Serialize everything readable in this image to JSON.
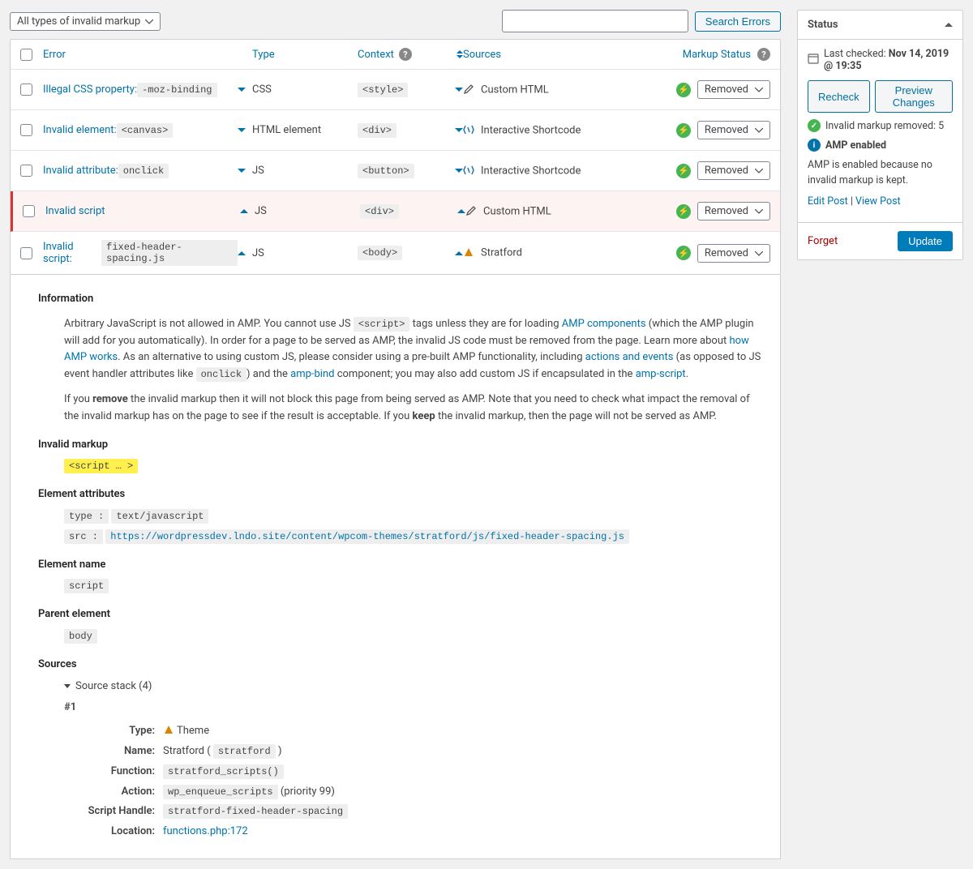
{
  "filter": {
    "label": "All types of invalid markup"
  },
  "search": {
    "button": "Search Errors"
  },
  "columns": {
    "error": "Error",
    "type": "Type",
    "context": "Context",
    "sources": "Sources",
    "status": "Markup Status"
  },
  "rows": [
    {
      "error_prefix": "Illegal CSS property:",
      "error_code": "-moz-binding",
      "type": "CSS",
      "context": "<style>",
      "source": "Custom HTML",
      "source_kind": "pencil",
      "status": "Removed",
      "expanded": false
    },
    {
      "error_prefix": "Invalid element:",
      "error_code": "<canvas>",
      "type": "HTML element",
      "context": "<div>",
      "source": "Interactive Shortcode",
      "source_kind": "shortcode",
      "status": "Removed",
      "expanded": false
    },
    {
      "error_prefix": "Invalid attribute:",
      "error_code": "onclick",
      "type": "JS",
      "context": "<button>",
      "source": "Interactive Shortcode",
      "source_kind": "shortcode",
      "status": "Removed",
      "expanded": false
    },
    {
      "error_prefix": "Invalid script",
      "error_code": "",
      "type": "JS",
      "context": "<div>",
      "source": "Custom HTML",
      "source_kind": "pencil",
      "status": "Removed",
      "expanded": true,
      "selected": true
    },
    {
      "error_prefix": "Invalid script:",
      "error_code": "fixed-header-spacing.js",
      "type": "JS",
      "context": "<body>",
      "source": "Stratford",
      "source_kind": "theme",
      "status": "Removed",
      "expanded": true
    }
  ],
  "detail": {
    "information_heading": "Information",
    "info_pre1": "Arbitrary JavaScript is not allowed in AMP. You cannot use JS ",
    "info_code1": "<script>",
    "info_post1": " tags unless they are for loading ",
    "link_amp_components": "AMP components",
    "info_post1b": " (which the AMP plugin will add for you automatically). In order for a page to be served as AMP, the invalid JS code must be removed from the page. Learn more about ",
    "link_how_amp_works": "how AMP works",
    "info_post1c": ". As an alternative to using custom JS, please consider using a pre-built AMP functionality, including ",
    "link_actions_events": "actions and events",
    "info_post1d": " (as opposed to JS event handler attributes like ",
    "info_code_onclick": "onclick",
    "info_post1e": ") and the ",
    "link_amp_bind": "amp-bind",
    "info_post1f": " component; you may also add custom JS if encapsulated in the ",
    "link_amp_script": "amp-script",
    "info_post1g": ".",
    "info2_pre": "If you ",
    "info2_b1": "remove",
    "info2_mid": " the invalid markup then it will not block this page from being served as AMP. Note that you need to check what impact the removal of the invalid markup has on the page to see if the result is acceptable. If you ",
    "info2_b2": "keep",
    "info2_post": " the invalid markup, then the page will not be served as AMP.",
    "invalid_markup_heading": "Invalid markup",
    "invalid_markup_code": "<script … >",
    "element_attributes_heading": "Element attributes",
    "attr_type_label": "type :",
    "attr_type_value": "text/javascript",
    "attr_src_label": "src :",
    "attr_src_value": "https://wordpressdev.lndo.site/content/wpcom-themes/stratford/js/fixed-header-spacing.js",
    "element_name_heading": "Element name",
    "element_name_value": "script",
    "parent_element_heading": "Parent element",
    "parent_element_value": "body",
    "sources_heading": "Sources",
    "source_stack_label": "Source stack (4)",
    "stack_number": "#1",
    "stack": {
      "type_label": "Type:",
      "type_value": "Theme",
      "name_label": "Name:",
      "name_value": "Stratford ( ",
      "name_code": "stratford",
      "name_value_post": " )",
      "function_label": "Function:",
      "function_value": "stratford_scripts()",
      "action_label": "Action:",
      "action_value": "wp_enqueue_scripts",
      "action_priority": " (priority 99)",
      "script_handle_label": "Script Handle:",
      "script_handle_value": "stratford-fixed-header-spacing",
      "location_label": "Location:",
      "location_value": "functions.php:172"
    }
  },
  "sidebar": {
    "status_title": "Status",
    "last_checked_label": "Last checked: ",
    "last_checked_value": "Nov 14, 2019 @ 19:35",
    "recheck": "Recheck",
    "preview_changes": "Preview Changes",
    "invalid_removed": "Invalid markup removed: 5",
    "amp_enabled": "AMP enabled",
    "amp_enabled_desc": "AMP is enabled because no invalid markup is kept.",
    "edit_post": "Edit Post",
    "view_post": "View Post",
    "forget": "Forget",
    "update": "Update"
  }
}
